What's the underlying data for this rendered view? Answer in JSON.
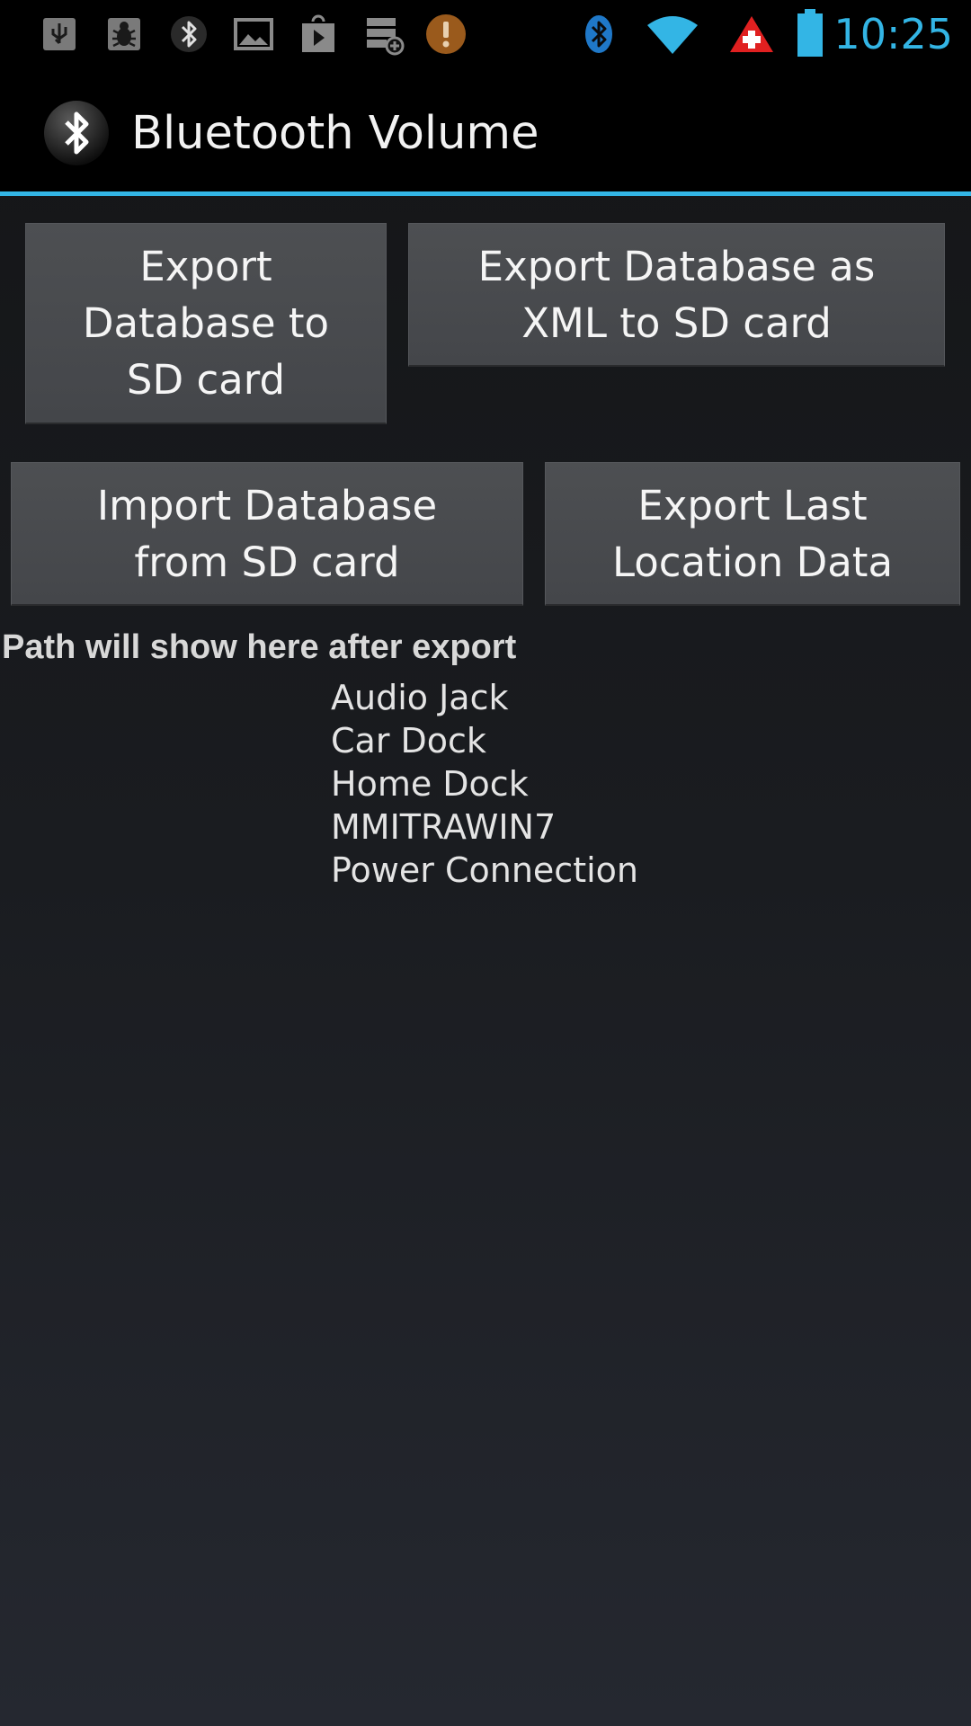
{
  "status_bar": {
    "left_icons": [
      "usb-icon",
      "bug-icon",
      "bluetooth-small-icon",
      "image-icon",
      "play-store-icon",
      "storage-add-icon",
      "warning-icon"
    ],
    "right_icons": [
      "bluetooth-status-icon",
      "wifi-icon",
      "swiss-flag-icon",
      "battery-icon"
    ],
    "time": "10:25",
    "accent_color": "#33b5e5"
  },
  "action_bar": {
    "title": "Bluetooth Volume",
    "icon": "bluetooth-icon"
  },
  "buttons": {
    "export_db": "Export\nDatabase to\nSD card",
    "export_xml": "Export Database as\nXML to SD card",
    "import_db": "Import Database\nfrom SD card",
    "export_location": "Export Last\nLocation Data"
  },
  "path_text": "Path will show here after export",
  "devices": [
    "Audio Jack",
    "Car Dock",
    "Home Dock",
    "MMITRAWIN7",
    "Power Connection"
  ]
}
